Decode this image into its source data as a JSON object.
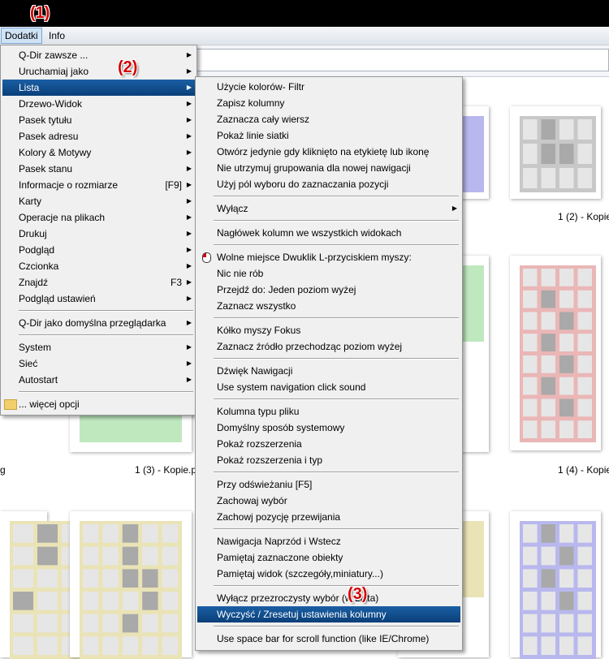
{
  "menubar": {
    "items": [
      "Dodatki",
      "Info"
    ]
  },
  "annotations": {
    "a1": "(1)",
    "a2": "(2)",
    "a3": "(3)"
  },
  "main_menu": {
    "items": [
      {
        "label": "Q-Dir zawsze ...",
        "shortcut": "",
        "arrow": true
      },
      {
        "label": "Uruchamiaj jako",
        "shortcut": "",
        "arrow": true
      },
      {
        "label": "Lista",
        "shortcut": "",
        "arrow": true
      },
      {
        "label": "Drzewo-Widok",
        "shortcut": "",
        "arrow": true
      },
      {
        "label": "Pasek tytułu",
        "shortcut": "",
        "arrow": true
      },
      {
        "label": "Pasek adresu",
        "shortcut": "",
        "arrow": true
      },
      {
        "label": "Kolory & Motywy",
        "shortcut": "",
        "arrow": true
      },
      {
        "label": "Pasek stanu",
        "shortcut": "",
        "arrow": true
      },
      {
        "label": "Informacje o rozmiarze",
        "shortcut": "[F9]",
        "arrow": true
      },
      {
        "label": "Karty",
        "shortcut": "",
        "arrow": true
      },
      {
        "label": "Operacje na plikach",
        "shortcut": "",
        "arrow": true
      },
      {
        "label": "Drukuj",
        "shortcut": "",
        "arrow": true
      },
      {
        "label": "Podgląd",
        "shortcut": "",
        "arrow": true
      },
      {
        "label": "Czcionka",
        "shortcut": "",
        "arrow": true
      },
      {
        "label": "Znajdź",
        "shortcut": "F3",
        "arrow": true
      },
      {
        "label": "Podgląd ustawień",
        "shortcut": "",
        "arrow": true
      },
      {
        "label": "Q-Dir jako domyślna przeglądarka",
        "shortcut": "",
        "arrow": true
      },
      {
        "label": "System",
        "shortcut": "",
        "arrow": true
      },
      {
        "label": "Sieć",
        "shortcut": "",
        "arrow": true
      },
      {
        "label": "Autostart",
        "shortcut": "",
        "arrow": true
      },
      {
        "label": "... więcej opcji",
        "shortcut": "",
        "arrow": false
      }
    ]
  },
  "submenu": {
    "items": [
      "Użycie kolorów- Filtr",
      "Zapisz kolumny",
      "Zaznacza cały wiersz",
      "Pokaż linie siatki",
      "Otwórz jedynie gdy kliknięto na etykietę lub ikonę",
      "Nie utrzymuj grupowania dla nowej nawigacji",
      "Użyj pól wyboru do zaznaczania pozycji",
      "Wyłącz",
      "Nagłówek kolumn we wszystkich widokach",
      "Wolne miejsce Dwuklik L-przyciskiem myszy:",
      "Nic nie rób",
      "Przejdź do: Jeden poziom wyżej",
      "Zaznacz wszystko",
      "Kółko myszy Fokus",
      "Zaznacz źródło przechodząc poziom wyżej",
      "Dźwięk Nawigacji",
      "Use system navigation click sound",
      "Kolumna typu pliku",
      "Domyślny sposób systemowy",
      "Pokaż rozszerzenia",
      "Pokaż rozszerzenia i typ",
      "Przy odświeżaniu [F5]",
      "Zachowaj wybór",
      "Zachowj pozycję przewijania",
      "Nawigacja Naprzód i Wstecz",
      "Pamiętaj zaznaczone obiekty",
      "Pamiętaj widok (szczegóły,miniatury...)",
      "Wyłącz przezroczysty wybór (w Lista)",
      "Wyczyść / Zresetuj ustawienia kolumny",
      "Use space bar for scroll function (like IE/Chrome)"
    ]
  },
  "captions": {
    "c1": "1 (2) - Kopie",
    "c2": "1 (3) - Kopie.p",
    "c3": "1 (4) - Kopie",
    "c4": "g"
  },
  "colors": {
    "highlight": "#0a4a8a",
    "gray_thumb": "#c8c8c8",
    "blue_thumb": "#b8b8ee",
    "green_thumb": "#bfe8bf",
    "red_thumb": "#eab6b6",
    "yellow_thumb": "#eae3b6"
  }
}
